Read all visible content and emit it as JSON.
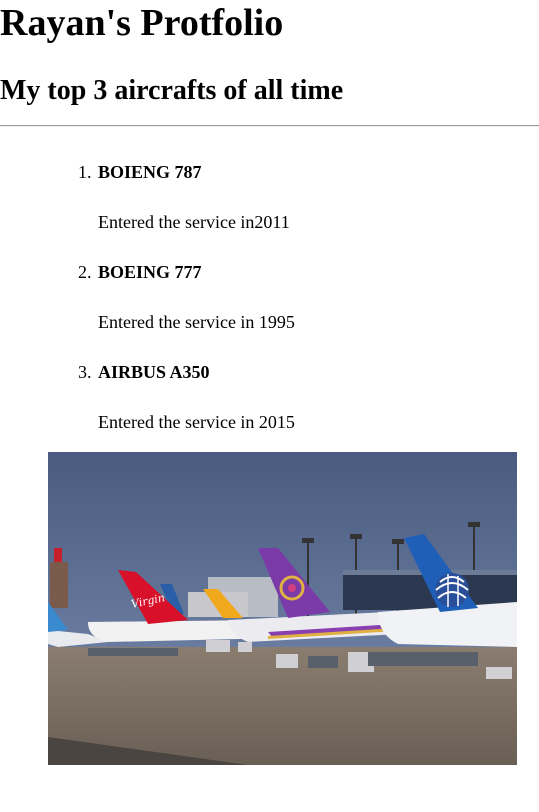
{
  "header": {
    "title": "Rayan's Protfolio",
    "subtitle": "My top 3 aircrafts of all time"
  },
  "aircraft": [
    {
      "number": "1.",
      "name": "BOIENG 787",
      "description": "Entered the service in2011"
    },
    {
      "number": "2.",
      "name": "BOEING 777",
      "description": "Entered the service in 1995"
    },
    {
      "number": "3.",
      "name": "AIRBUS A350",
      "description": "Entered the service in 2015"
    }
  ],
  "photo": {
    "subject": "airliners-at-airport-photo",
    "tail_logos": [
      "Virgin"
    ],
    "colors": {
      "sky": "#4f5f83",
      "ground": "#7a6e62",
      "virgin_red": "#d8102a",
      "thai_purple": "#7a3aa8",
      "united_blue": "#1f5fb8",
      "yellow_tail": "#f0a81c"
    }
  }
}
